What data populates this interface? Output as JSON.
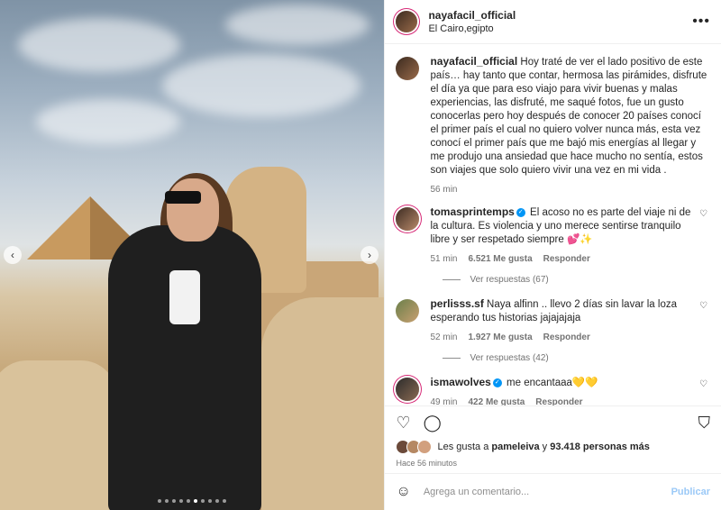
{
  "header": {
    "username": "nayafacil_official",
    "location": "El Cairo,egipto",
    "more_icon": "more-horizontal-icon"
  },
  "caption": {
    "username": "nayafacil_official",
    "text": "Hoy traté de ver el lado positivo de este país… hay tanto que contar, hermosa las pirámides, disfrute el día ya que para eso viajo para vivir buenas y malas experiencias, las disfruté, me saqué fotos, fue un gusto conocerlas pero hoy después de conocer 20 países conocí el primer país el cual no quiero volver nunca más, esta vez conocí el primer país que me bajó mis energías al llegar y me produjo una ansiedad que hace mucho no sentía, estos son viajes que solo quiero vivir una vez en mi vida .",
    "time": "56 min"
  },
  "comments": [
    {
      "username": "tomasprintemps",
      "verified": true,
      "text": "El acoso no es parte del viaje ni de la cultura. Es violencia y uno merece sentirse tranquilo libre y ser respetado siempre 💕✨",
      "time": "51 min",
      "likes": "6.521 Me gusta",
      "reply": "Responder",
      "view_replies": "Ver respuestas (67)"
    },
    {
      "username": "perlisss.sf",
      "verified": false,
      "text": "Naya alfinn .. llevo 2 días sin lavar la loza esperando tus historias jajajajaja",
      "time": "52 min",
      "likes": "1.927 Me gusta",
      "reply": "Responder",
      "view_replies": "Ver respuestas (42)"
    },
    {
      "username": "ismawolves",
      "verified": true,
      "text": "me encantaaa💛💛",
      "time": "49 min",
      "likes": "422 Me gusta",
      "reply": "Responder"
    }
  ],
  "actions": {
    "like_icon": "heart-icon",
    "comment_icon": "comment-icon",
    "save_icon": "bookmark-icon"
  },
  "likes": {
    "prefix": "Les gusta a",
    "user": "pameleiva",
    "conj": "y",
    "count": "93.418 personas más"
  },
  "posted": "Hace 56 minutos",
  "add_comment": {
    "placeholder": "Agrega un comentario...",
    "post_label": "Publicar"
  },
  "carousel": {
    "total": 10,
    "active": 5
  }
}
